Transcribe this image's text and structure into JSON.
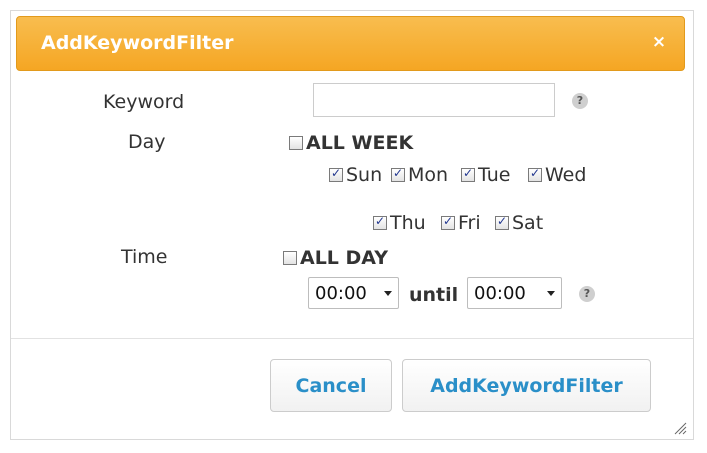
{
  "dialog": {
    "title": "AddKeywordFilter",
    "close_symbol": "×"
  },
  "form": {
    "keyword_label": "Keyword",
    "keyword_value": "",
    "day_label": "Day",
    "all_week_label": "ALL WEEK",
    "all_week_checked": false,
    "days": [
      {
        "label": "Sun",
        "checked": true
      },
      {
        "label": "Mon",
        "checked": true
      },
      {
        "label": "Tue",
        "checked": true
      },
      {
        "label": "Wed",
        "checked": true
      },
      {
        "label": "Thu",
        "checked": true
      },
      {
        "label": "Fri",
        "checked": true
      },
      {
        "label": "Sat",
        "checked": true
      }
    ],
    "time_label": "Time",
    "all_day_label": "ALL DAY",
    "all_day_checked": false,
    "start_time": "00:00",
    "until_label": "until",
    "end_time": "00:00",
    "help_symbol": "?"
  },
  "buttons": {
    "cancel": "Cancel",
    "submit": "AddKeywordFilter"
  },
  "colors": {
    "titlebar": "#f5a623",
    "button_text": "#2a8fc8",
    "check": "#22378f"
  }
}
